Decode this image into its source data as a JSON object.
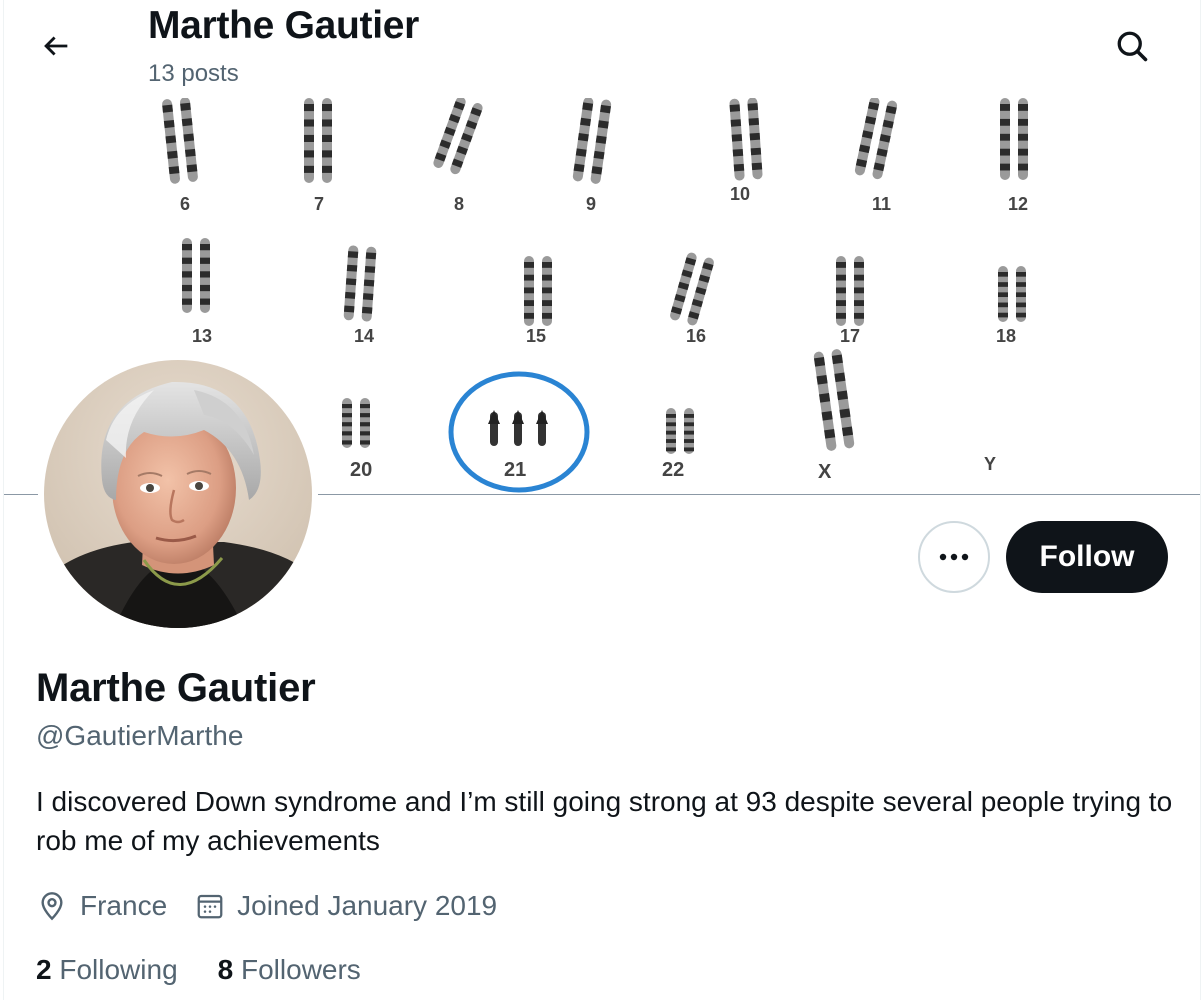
{
  "header": {
    "title": "Marthe Gautier",
    "posts_count": "13 posts"
  },
  "banner": {
    "row1_labels": [
      "6",
      "7",
      "8",
      "9",
      "10",
      "11",
      "12"
    ],
    "row2_labels": [
      "13",
      "14",
      "15",
      "16",
      "17",
      "18"
    ],
    "row3_labels": [
      "20",
      "21",
      "22",
      "X",
      "Y"
    ],
    "highlight_color": "#2a84d3"
  },
  "profile": {
    "name": "Marthe Gautier",
    "handle": "@GautierMarthe",
    "bio": "I discovered Down syndrome and I’m still going strong at 93 despite several people trying to rob me of my achievements",
    "location": "France",
    "joined": "Joined January 2019"
  },
  "actions": {
    "follow_label": "Follow"
  },
  "stats": {
    "following_count": "2",
    "following_label": "Following",
    "followers_count": "8",
    "followers_label": "Followers"
  },
  "icons": {
    "back": "arrow-left-icon",
    "search": "search-icon",
    "more": "ellipsis-icon",
    "location": "location-pin-icon",
    "calendar": "calendar-icon"
  },
  "colors": {
    "text_primary": "#0f1419",
    "text_secondary": "#536471",
    "button_dark": "#0f1419"
  }
}
